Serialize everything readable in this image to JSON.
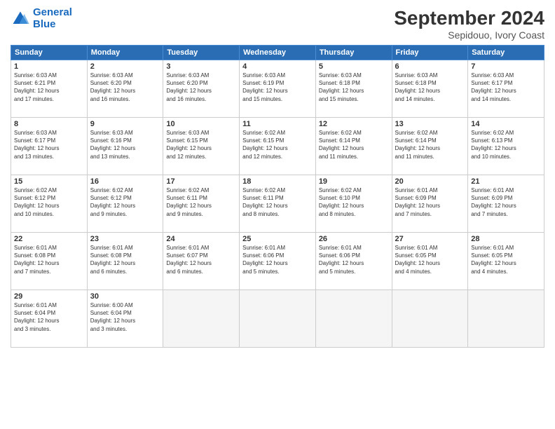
{
  "header": {
    "logo_line1": "General",
    "logo_line2": "Blue",
    "month": "September 2024",
    "location": "Sepidouo, Ivory Coast"
  },
  "weekdays": [
    "Sunday",
    "Monday",
    "Tuesday",
    "Wednesday",
    "Thursday",
    "Friday",
    "Saturday"
  ],
  "days": [
    {
      "num": "",
      "info": ""
    },
    {
      "num": "",
      "info": ""
    },
    {
      "num": "",
      "info": ""
    },
    {
      "num": "",
      "info": ""
    },
    {
      "num": "",
      "info": ""
    },
    {
      "num": "",
      "info": ""
    },
    {
      "num": "",
      "info": ""
    },
    {
      "num": "1",
      "info": "Sunrise: 6:03 AM\nSunset: 6:21 PM\nDaylight: 12 hours\nand 17 minutes."
    },
    {
      "num": "2",
      "info": "Sunrise: 6:03 AM\nSunset: 6:20 PM\nDaylight: 12 hours\nand 16 minutes."
    },
    {
      "num": "3",
      "info": "Sunrise: 6:03 AM\nSunset: 6:20 PM\nDaylight: 12 hours\nand 16 minutes."
    },
    {
      "num": "4",
      "info": "Sunrise: 6:03 AM\nSunset: 6:19 PM\nDaylight: 12 hours\nand 15 minutes."
    },
    {
      "num": "5",
      "info": "Sunrise: 6:03 AM\nSunset: 6:18 PM\nDaylight: 12 hours\nand 15 minutes."
    },
    {
      "num": "6",
      "info": "Sunrise: 6:03 AM\nSunset: 6:18 PM\nDaylight: 12 hours\nand 14 minutes."
    },
    {
      "num": "7",
      "info": "Sunrise: 6:03 AM\nSunset: 6:17 PM\nDaylight: 12 hours\nand 14 minutes."
    },
    {
      "num": "8",
      "info": "Sunrise: 6:03 AM\nSunset: 6:17 PM\nDaylight: 12 hours\nand 13 minutes."
    },
    {
      "num": "9",
      "info": "Sunrise: 6:03 AM\nSunset: 6:16 PM\nDaylight: 12 hours\nand 13 minutes."
    },
    {
      "num": "10",
      "info": "Sunrise: 6:03 AM\nSunset: 6:15 PM\nDaylight: 12 hours\nand 12 minutes."
    },
    {
      "num": "11",
      "info": "Sunrise: 6:02 AM\nSunset: 6:15 PM\nDaylight: 12 hours\nand 12 minutes."
    },
    {
      "num": "12",
      "info": "Sunrise: 6:02 AM\nSunset: 6:14 PM\nDaylight: 12 hours\nand 11 minutes."
    },
    {
      "num": "13",
      "info": "Sunrise: 6:02 AM\nSunset: 6:14 PM\nDaylight: 12 hours\nand 11 minutes."
    },
    {
      "num": "14",
      "info": "Sunrise: 6:02 AM\nSunset: 6:13 PM\nDaylight: 12 hours\nand 10 minutes."
    },
    {
      "num": "15",
      "info": "Sunrise: 6:02 AM\nSunset: 6:12 PM\nDaylight: 12 hours\nand 10 minutes."
    },
    {
      "num": "16",
      "info": "Sunrise: 6:02 AM\nSunset: 6:12 PM\nDaylight: 12 hours\nand 9 minutes."
    },
    {
      "num": "17",
      "info": "Sunrise: 6:02 AM\nSunset: 6:11 PM\nDaylight: 12 hours\nand 9 minutes."
    },
    {
      "num": "18",
      "info": "Sunrise: 6:02 AM\nSunset: 6:11 PM\nDaylight: 12 hours\nand 8 minutes."
    },
    {
      "num": "19",
      "info": "Sunrise: 6:02 AM\nSunset: 6:10 PM\nDaylight: 12 hours\nand 8 minutes."
    },
    {
      "num": "20",
      "info": "Sunrise: 6:01 AM\nSunset: 6:09 PM\nDaylight: 12 hours\nand 7 minutes."
    },
    {
      "num": "21",
      "info": "Sunrise: 6:01 AM\nSunset: 6:09 PM\nDaylight: 12 hours\nand 7 minutes."
    },
    {
      "num": "22",
      "info": "Sunrise: 6:01 AM\nSunset: 6:08 PM\nDaylight: 12 hours\nand 7 minutes."
    },
    {
      "num": "23",
      "info": "Sunrise: 6:01 AM\nSunset: 6:08 PM\nDaylight: 12 hours\nand 6 minutes."
    },
    {
      "num": "24",
      "info": "Sunrise: 6:01 AM\nSunset: 6:07 PM\nDaylight: 12 hours\nand 6 minutes."
    },
    {
      "num": "25",
      "info": "Sunrise: 6:01 AM\nSunset: 6:06 PM\nDaylight: 12 hours\nand 5 minutes."
    },
    {
      "num": "26",
      "info": "Sunrise: 6:01 AM\nSunset: 6:06 PM\nDaylight: 12 hours\nand 5 minutes."
    },
    {
      "num": "27",
      "info": "Sunrise: 6:01 AM\nSunset: 6:05 PM\nDaylight: 12 hours\nand 4 minutes."
    },
    {
      "num": "28",
      "info": "Sunrise: 6:01 AM\nSunset: 6:05 PM\nDaylight: 12 hours\nand 4 minutes."
    },
    {
      "num": "29",
      "info": "Sunrise: 6:01 AM\nSunset: 6:04 PM\nDaylight: 12 hours\nand 3 minutes."
    },
    {
      "num": "30",
      "info": "Sunrise: 6:00 AM\nSunset: 6:04 PM\nDaylight: 12 hours\nand 3 minutes."
    },
    {
      "num": "",
      "info": ""
    },
    {
      "num": "",
      "info": ""
    },
    {
      "num": "",
      "info": ""
    },
    {
      "num": "",
      "info": ""
    },
    {
      "num": "",
      "info": ""
    }
  ]
}
